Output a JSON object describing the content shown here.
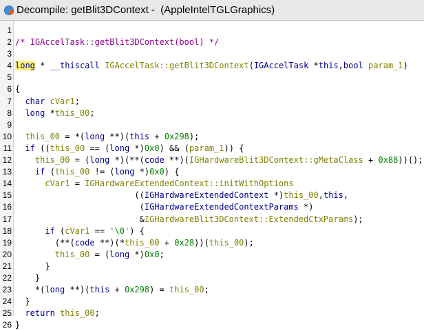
{
  "window": {
    "title": "Decompile: getBlit3DContext -  (AppleIntelTGLGraphics)",
    "app_icon": "ghidra-dragon-icon",
    "colors": {
      "keyword": "#00008b",
      "function": "#808000",
      "variable": "#808000",
      "comment": "#8b008b",
      "number": "#008000",
      "highlight": "#fff27a"
    }
  },
  "code_lines": [
    {
      "num": "1",
      "tokens": []
    },
    {
      "num": "2",
      "tokens": [
        {
          "t": "/* IGAccelTask::getBlit3DContext(bool) */",
          "c": "cm"
        }
      ]
    },
    {
      "num": "3",
      "tokens": []
    },
    {
      "num": "4",
      "tokens": [
        {
          "t": "long",
          "c": "ty hl"
        },
        {
          "t": " * ",
          "c": "pu"
        },
        {
          "t": "__thiscall",
          "c": "kw"
        },
        {
          "t": " ",
          "c": "pu"
        },
        {
          "t": "IGAccelTask::getBlit3DContext",
          "c": "fn"
        },
        {
          "t": "(",
          "c": "pu"
        },
        {
          "t": "IGAccelTask",
          "c": "ty"
        },
        {
          "t": " *",
          "c": "pu"
        },
        {
          "t": "this",
          "c": "kw"
        },
        {
          "t": ",",
          "c": "pu"
        },
        {
          "t": "bool",
          "c": "ty"
        },
        {
          "t": " ",
          "c": "pu"
        },
        {
          "t": "param_1",
          "c": "vr"
        },
        {
          "t": ")",
          "c": "pu"
        }
      ]
    },
    {
      "num": "5",
      "tokens": []
    },
    {
      "num": "6",
      "tokens": [
        {
          "t": "{",
          "c": "pu"
        }
      ]
    },
    {
      "num": "7",
      "tokens": [
        {
          "t": "  ",
          "c": "pu"
        },
        {
          "t": "char",
          "c": "ty"
        },
        {
          "t": " ",
          "c": "pu"
        },
        {
          "t": "cVar1",
          "c": "vr"
        },
        {
          "t": ";",
          "c": "pu"
        }
      ]
    },
    {
      "num": "8",
      "tokens": [
        {
          "t": "  ",
          "c": "pu"
        },
        {
          "t": "long",
          "c": "ty"
        },
        {
          "t": " *",
          "c": "pu"
        },
        {
          "t": "this_00",
          "c": "vr"
        },
        {
          "t": ";",
          "c": "pu"
        }
      ]
    },
    {
      "num": "9",
      "tokens": []
    },
    {
      "num": "10",
      "tokens": [
        {
          "t": "  ",
          "c": "pu"
        },
        {
          "t": "this_00",
          "c": "vr"
        },
        {
          "t": " = *(",
          "c": "pu"
        },
        {
          "t": "long",
          "c": "ty"
        },
        {
          "t": " **)(",
          "c": "pu"
        },
        {
          "t": "this",
          "c": "kw"
        },
        {
          "t": " + ",
          "c": "pu"
        },
        {
          "t": "0x298",
          "c": "nm"
        },
        {
          "t": ");",
          "c": "pu"
        }
      ]
    },
    {
      "num": "11",
      "tokens": [
        {
          "t": "  ",
          "c": "pu"
        },
        {
          "t": "if",
          "c": "kw"
        },
        {
          "t": " ((",
          "c": "pu"
        },
        {
          "t": "this_00",
          "c": "vr"
        },
        {
          "t": " == (",
          "c": "pu"
        },
        {
          "t": "long",
          "c": "ty"
        },
        {
          "t": " *)",
          "c": "pu"
        },
        {
          "t": "0x0",
          "c": "nm"
        },
        {
          "t": ") && (",
          "c": "pu"
        },
        {
          "t": "param_1",
          "c": "vr"
        },
        {
          "t": ")) {",
          "c": "pu"
        }
      ]
    },
    {
      "num": "12",
      "tokens": [
        {
          "t": "    ",
          "c": "pu"
        },
        {
          "t": "this_00",
          "c": "vr"
        },
        {
          "t": " = (",
          "c": "pu"
        },
        {
          "t": "long",
          "c": "ty"
        },
        {
          "t": " *)(**(",
          "c": "pu"
        },
        {
          "t": "code",
          "c": "ty"
        },
        {
          "t": " **)(",
          "c": "pu"
        },
        {
          "t": "IGHardwareBlit3DContext::gMetaClass",
          "c": "vr"
        },
        {
          "t": " + ",
          "c": "pu"
        },
        {
          "t": "0x88",
          "c": "nm"
        },
        {
          "t": "))();",
          "c": "pu"
        }
      ]
    },
    {
      "num": "13",
      "tokens": [
        {
          "t": "    ",
          "c": "pu"
        },
        {
          "t": "if",
          "c": "kw"
        },
        {
          "t": " (",
          "c": "pu"
        },
        {
          "t": "this_00",
          "c": "vr"
        },
        {
          "t": " != (",
          "c": "pu"
        },
        {
          "t": "long",
          "c": "ty"
        },
        {
          "t": " *)",
          "c": "pu"
        },
        {
          "t": "0x0",
          "c": "nm"
        },
        {
          "t": ") {",
          "c": "pu"
        }
      ]
    },
    {
      "num": "14",
      "tokens": [
        {
          "t": "      ",
          "c": "pu"
        },
        {
          "t": "cVar1",
          "c": "vr"
        },
        {
          "t": " = ",
          "c": "pu"
        },
        {
          "t": "IGHardwareExtendedContext::initWithOptions",
          "c": "fn"
        }
      ]
    },
    {
      "num": "15",
      "tokens": [
        {
          "t": "                        ((",
          "c": "pu"
        },
        {
          "t": "IGHardwareExtendedContext",
          "c": "ty"
        },
        {
          "t": " *)",
          "c": "pu"
        },
        {
          "t": "this_00",
          "c": "vr"
        },
        {
          "t": ",",
          "c": "pu"
        },
        {
          "t": "this",
          "c": "kw"
        },
        {
          "t": ",",
          "c": "pu"
        }
      ]
    },
    {
      "num": "16",
      "tokens": [
        {
          "t": "                         (",
          "c": "pu"
        },
        {
          "t": "IGHardwareExtendedContextParams",
          "c": "ty"
        },
        {
          "t": " *)",
          "c": "pu"
        }
      ]
    },
    {
      "num": "17",
      "tokens": [
        {
          "t": "                         &",
          "c": "pu"
        },
        {
          "t": "IGHardwareBlit3DContext::ExtendedCtxParams",
          "c": "vr"
        },
        {
          "t": ");",
          "c": "pu"
        }
      ]
    },
    {
      "num": "18",
      "tokens": [
        {
          "t": "      ",
          "c": "pu"
        },
        {
          "t": "if",
          "c": "kw"
        },
        {
          "t": " (",
          "c": "pu"
        },
        {
          "t": "cVar1",
          "c": "vr"
        },
        {
          "t": " == ",
          "c": "pu"
        },
        {
          "t": "'\\0'",
          "c": "nm"
        },
        {
          "t": ") {",
          "c": "pu"
        }
      ]
    },
    {
      "num": "19",
      "tokens": [
        {
          "t": "        (**(",
          "c": "pu"
        },
        {
          "t": "code",
          "c": "ty"
        },
        {
          "t": " **)(*",
          "c": "pu"
        },
        {
          "t": "this_00",
          "c": "vr"
        },
        {
          "t": " + ",
          "c": "pu"
        },
        {
          "t": "0x28",
          "c": "nm"
        },
        {
          "t": "))(",
          "c": "pu"
        },
        {
          "t": "this_00",
          "c": "vr"
        },
        {
          "t": ");",
          "c": "pu"
        }
      ]
    },
    {
      "num": "20",
      "tokens": [
        {
          "t": "        ",
          "c": "pu"
        },
        {
          "t": "this_00",
          "c": "vr"
        },
        {
          "t": " = (",
          "c": "pu"
        },
        {
          "t": "long",
          "c": "ty"
        },
        {
          "t": " *)",
          "c": "pu"
        },
        {
          "t": "0x0",
          "c": "nm"
        },
        {
          "t": ";",
          "c": "pu"
        }
      ]
    },
    {
      "num": "21",
      "tokens": [
        {
          "t": "      }",
          "c": "pu"
        }
      ]
    },
    {
      "num": "22",
      "tokens": [
        {
          "t": "    }",
          "c": "pu"
        }
      ]
    },
    {
      "num": "23",
      "tokens": [
        {
          "t": "    *(",
          "c": "pu"
        },
        {
          "t": "long",
          "c": "ty"
        },
        {
          "t": " **)(",
          "c": "pu"
        },
        {
          "t": "this",
          "c": "kw"
        },
        {
          "t": " + ",
          "c": "pu"
        },
        {
          "t": "0x298",
          "c": "nm"
        },
        {
          "t": ") = ",
          "c": "pu"
        },
        {
          "t": "this_00",
          "c": "vr"
        },
        {
          "t": ";",
          "c": "pu"
        }
      ]
    },
    {
      "num": "24",
      "tokens": [
        {
          "t": "  }",
          "c": "pu"
        }
      ]
    },
    {
      "num": "25",
      "tokens": [
        {
          "t": "  ",
          "c": "pu"
        },
        {
          "t": "return",
          "c": "kw"
        },
        {
          "t": " ",
          "c": "pu"
        },
        {
          "t": "this_00",
          "c": "vr"
        },
        {
          "t": ";",
          "c": "pu"
        }
      ]
    },
    {
      "num": "26",
      "tokens": [
        {
          "t": "}",
          "c": "pu"
        }
      ]
    }
  ]
}
